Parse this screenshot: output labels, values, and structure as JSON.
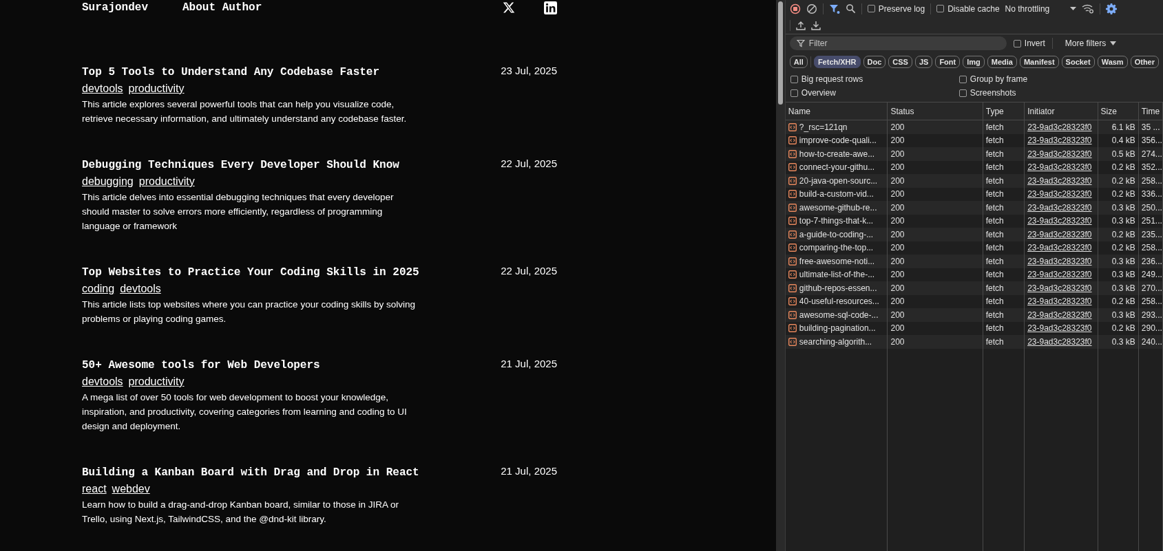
{
  "site": {
    "brand": "Surajondev",
    "links": [
      "About Author"
    ],
    "articles": [
      {
        "title": "Top 5 Tools to Understand Any Codebase Faster",
        "tags": [
          "devtools",
          "productivity"
        ],
        "description": "This article explores several powerful tools that can help you visualize code, retrieve necessary information, and ultimately understand any codebase faster.",
        "date": "23 Jul, 2025"
      },
      {
        "title": "Debugging Techniques Every Developer Should Know",
        "tags": [
          "debugging",
          "productivity"
        ],
        "description": "This article delves into essential debugging techniques that every developer should master to solve errors more efficiently, regardless of programming language or framework",
        "date": "22 Jul, 2025"
      },
      {
        "title": "Top Websites to Practice Your Coding Skills in 2025",
        "tags": [
          "coding",
          "devtools"
        ],
        "description": "This article lists top websites where you can practice your coding skills by solving problems or playing coding games.",
        "date": "22 Jul, 2025"
      },
      {
        "title": "50+ Awesome tools for Web Developers",
        "tags": [
          "devtools",
          "productivity"
        ],
        "description": "A mega list of over 50 tools for web development to boost your knowledge, inspiration, and productivity, covering categories from learning and coding to UI design and deployment.",
        "date": "21 Jul, 2025"
      },
      {
        "title": "Building a Kanban Board with Drag and Drop in React",
        "tags": [
          "react",
          "webdev"
        ],
        "description": "Learn how to build a drag-and-drop Kanban board, similar to those in JIRA or Trello, using Next.js, TailwindCSS, and the @dnd-kit library.",
        "date": "21 Jul, 2025"
      }
    ]
  },
  "devtools": {
    "toolbar": {
      "recording": true,
      "filter_active": true,
      "preserve_log": {
        "label": "Preserve log",
        "checked": false
      },
      "disable_cache": {
        "label": "Disable cache",
        "checked": false
      },
      "throttling": "No throttling"
    },
    "filter": {
      "placeholder": "Filter",
      "invert": {
        "label": "Invert",
        "checked": false
      },
      "more_filters": "More filters"
    },
    "types": [
      {
        "label": "All",
        "selected": false
      },
      {
        "label": "Fetch/XHR",
        "selected": true
      },
      {
        "label": "Doc",
        "selected": false
      },
      {
        "label": "CSS",
        "selected": false
      },
      {
        "label": "JS",
        "selected": false
      },
      {
        "label": "Font",
        "selected": false
      },
      {
        "label": "Img",
        "selected": false
      },
      {
        "label": "Media",
        "selected": false
      },
      {
        "label": "Manifest",
        "selected": false
      },
      {
        "label": "Socket",
        "selected": false
      },
      {
        "label": "Wasm",
        "selected": false
      },
      {
        "label": "Other",
        "selected": false
      }
    ],
    "options": [
      {
        "label": "Big request rows",
        "checked": false
      },
      {
        "label": "Group by frame",
        "checked": false
      },
      {
        "label": "Overview",
        "checked": false
      },
      {
        "label": "Screenshots",
        "checked": false
      }
    ],
    "table": {
      "columns": [
        "Name",
        "Status",
        "Type",
        "Initiator",
        "Size",
        "Time"
      ],
      "rows": [
        [
          "?_rsc=121qn",
          "200",
          "fetch",
          "23-9ad3c28323f0",
          "6.1 kB",
          "35 ..."
        ],
        [
          "improve-code-quali...",
          "200",
          "fetch",
          "23-9ad3c28323f0",
          "0.4 kB",
          "356..."
        ],
        [
          "how-to-create-awe...",
          "200",
          "fetch",
          "23-9ad3c28323f0",
          "0.5 kB",
          "274..."
        ],
        [
          "connect-your-githu...",
          "200",
          "fetch",
          "23-9ad3c28323f0",
          "0.2 kB",
          "352..."
        ],
        [
          "20-java-open-sourc...",
          "200",
          "fetch",
          "23-9ad3c28323f0",
          "0.2 kB",
          "258..."
        ],
        [
          "build-a-custom-vid...",
          "200",
          "fetch",
          "23-9ad3c28323f0",
          "0.2 kB",
          "336..."
        ],
        [
          "awesome-github-re...",
          "200",
          "fetch",
          "23-9ad3c28323f0",
          "0.3 kB",
          "250..."
        ],
        [
          "top-7-things-that-k...",
          "200",
          "fetch",
          "23-9ad3c28323f0",
          "0.3 kB",
          "251..."
        ],
        [
          "a-guide-to-coding-...",
          "200",
          "fetch",
          "23-9ad3c28323f0",
          "0.2 kB",
          "235..."
        ],
        [
          "comparing-the-top...",
          "200",
          "fetch",
          "23-9ad3c28323f0",
          "0.2 kB",
          "258..."
        ],
        [
          "free-awesome-noti...",
          "200",
          "fetch",
          "23-9ad3c28323f0",
          "0.3 kB",
          "236..."
        ],
        [
          "ultimate-list-of-the-...",
          "200",
          "fetch",
          "23-9ad3c28323f0",
          "0.3 kB",
          "249..."
        ],
        [
          "github-repos-essen...",
          "200",
          "fetch",
          "23-9ad3c28323f0",
          "0.3 kB",
          "270..."
        ],
        [
          "40-useful-resources...",
          "200",
          "fetch",
          "23-9ad3c28323f0",
          "0.2 kB",
          "258..."
        ],
        [
          "awesome-sql-code-...",
          "200",
          "fetch",
          "23-9ad3c28323f0",
          "0.3 kB",
          "293..."
        ],
        [
          "building-pagination...",
          "200",
          "fetch",
          "23-9ad3c28323f0",
          "0.2 kB",
          "290..."
        ],
        [
          "searching-algorith...",
          "200",
          "fetch",
          "23-9ad3c28323f0",
          "0.3 kB",
          "240..."
        ]
      ]
    }
  }
}
